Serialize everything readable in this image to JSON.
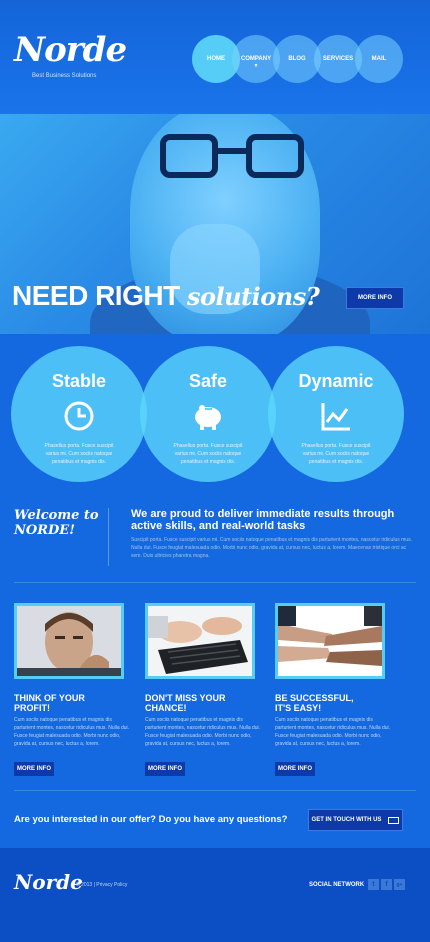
{
  "brand": {
    "logo": "Norde",
    "tagline": "Best Business Solutions"
  },
  "nav": [
    {
      "label": "HOME",
      "active": true
    },
    {
      "label": "COMPANY",
      "active": false,
      "has_dropdown": true
    },
    {
      "label": "BLOG",
      "active": false
    },
    {
      "label": "SERVICES",
      "active": false
    },
    {
      "label": "MAIL",
      "active": false
    }
  ],
  "hero": {
    "headline_main": "NEED RIGHT",
    "headline_script": "solutions?",
    "button": "MORE INFO"
  },
  "features": [
    {
      "title": "Stable",
      "icon": "clock-icon",
      "text": "Phasellus porta. Fusce suscipit varius mi. Cum sociis natoque penatibus et magnis dis."
    },
    {
      "title": "Safe",
      "icon": "piggy-bank-icon",
      "text": "Phasellus porta. Fusce suscipit varius mi. Cum sociis natoque penatibus et magnis dis."
    },
    {
      "title": "Dynamic",
      "icon": "line-chart-icon",
      "text": "Phasellus porta. Fusce suscipit varius mi. Cum sociis natoque penatibus et magnis dis."
    }
  ],
  "welcome": {
    "title_line1": "Welcome to",
    "title_line2": "NORDE!",
    "lead": "We are proud to deliver immediate results through active skills, and real-world tasks",
    "body": "Suscipit porta. Fusce suscipit varius mi. Cum sociis natoque penatibus et magnis dis parturient montes, nascetur ridiculus mus. Nulla dui. Fusce feugiat malesuada odio. Morbi nunc odio, gravida at, cursus nec, luctus a, lorem. Maecenas tristique orci ac sem. Duis ultricies pharetra magna."
  },
  "cards": [
    {
      "title_line1": "THINK OF YOUR",
      "title_line2": "PROFIT!",
      "text": "Cum sociis natoque penatibus et magnis dis parturient montes, nascetur ridiculus mus. Nulla dui. Fusce feugiat malesuada odio. Morbi nunc odio, gravida at, cursus nec, luctus a, lorem.",
      "button": "MORE INFO"
    },
    {
      "title_line1": "DON'T MISS YOUR",
      "title_line2": "CHANCE!",
      "text": "Cum sociis natoque penatibus et magnis dis parturient montes, nascetur ridiculus mus. Nulla dui. Fusce feugiat malesuada odio. Morbi nunc odio, gravida at, cursus nec, luctus a, lorem.",
      "button": "MORE INFO"
    },
    {
      "title_line1": "BE SUCCESSFUL,",
      "title_line2": "IT'S EASY!",
      "text": "Cum sociis natoque penatibus et magnis dis parturient montes, nascetur ridiculus mus. Nulla dui. Fusce feugiat malesuada odio. Morbi nunc odio, gravida at, cursus nec, luctus a, lorem.",
      "button": "MORE INFO"
    }
  ],
  "cta": {
    "text": "Are you interested in our offer? Do you have any questions?",
    "button": "GET IN TOUCH WITH US"
  },
  "footer": {
    "logo": "Norde",
    "copyright": "© 2013  |  Privacy Policy",
    "social_label": "SOCIAL NETWORK",
    "social": [
      {
        "name": "twitter-icon",
        "glyph": "t"
      },
      {
        "name": "facebook-icon",
        "glyph": "f"
      },
      {
        "name": "google-plus-icon",
        "glyph": "g+"
      }
    ]
  },
  "colors": {
    "background": "#1468e0",
    "accent": "#56cdf6",
    "button": "#0d3aa8",
    "footer": "#0c4ec4"
  }
}
